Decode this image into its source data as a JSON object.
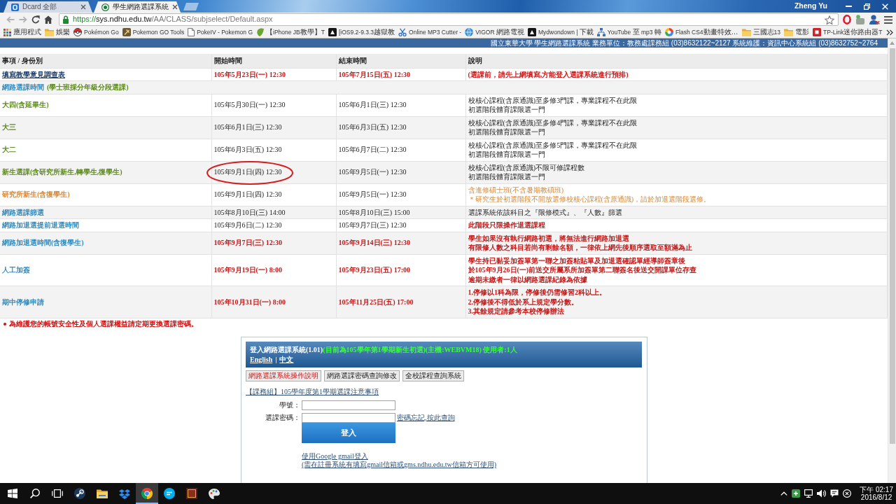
{
  "browser": {
    "tabs": [
      {
        "kind": "tile",
        "title": "Dcard 全部",
        "selected": false
      },
      {
        "kind": "seal",
        "title": "學生網路選課系統",
        "selected": true
      }
    ],
    "user": "Zheng Yu",
    "back_disabled": true,
    "forward_disabled": true,
    "address": {
      "scheme": "https://",
      "host": "sys.ndhu.edu.tw",
      "path": "/AA/CLASS/subjselect/Default.aspx"
    },
    "bookmarks": [
      {
        "kind": "apps",
        "label": "應用程式"
      },
      {
        "kind": "folder",
        "label": "娛樂"
      },
      {
        "kind": "ball",
        "label": "Pokémon Go"
      },
      {
        "kind": "tool",
        "label": "Pokemon GO Tools"
      },
      {
        "kind": "page",
        "label": "PokeIV - Pokemon G"
      },
      {
        "kind": "leaf",
        "label": "【iPhone JB教學】T"
      },
      {
        "kind": "tile",
        "label": "[iOS9.2-9.3.3越獄教"
      },
      {
        "kind": "scissors",
        "label": "Online MP3 Cutter -"
      },
      {
        "kind": "globe",
        "label": "VIGOR 網路電視"
      },
      {
        "kind": "tile",
        "label": "Mydwondown | 下載"
      },
      {
        "kind": "network",
        "label": "YouTube 至 mp3 轉"
      },
      {
        "kind": "pinwheel",
        "label": "Flash CS4動畫特效…"
      },
      {
        "kind": "folder",
        "label": "三國志13"
      },
      {
        "kind": "folder",
        "label": "電影"
      },
      {
        "kind": "logo",
        "label": "TP-Link迷你路由器T"
      }
    ]
  },
  "page": {
    "header": "國立東華大學 學生網路選課系統 業務單位：教務處課務組 (03)8632122~2127 系統維護：資訊中心系統組 (03)8632752~2764",
    "table": {
      "columns": [
        "事項 / 身份別",
        "開始時間",
        "結束時間",
        "說明"
      ],
      "rows": [
        {
          "kind": "survey",
          "item": "填寫教學意見調查表",
          "start": "105年5月23日(一) 12:30",
          "end": "105年7月15日(五) 12:30",
          "dates_emphasized": true,
          "notes": [
            "(選課前，請先上網填寫,方能登入選課系統進行預排)"
          ],
          "notes_emphasized": true,
          "start_circled": false
        },
        {
          "kind": "section",
          "item": "網路選課時間",
          "subtitle": "(學士班採分年級分段選課)"
        },
        {
          "kind": "cohort",
          "item": "大四(含延畢生)",
          "start": "105年5月30日(一) 12:30",
          "end": "105年6月1日(三) 12:30",
          "dates_emphasized": false,
          "notes": [
            "校核心課程(含原通識)至多修3門課，專業課程不在此限",
            "初選階段體育課限選一門"
          ],
          "notes_emphasized": false,
          "start_circled": false
        },
        {
          "kind": "cohort",
          "item": "大三",
          "start": "105年6月1日(三) 12:30",
          "end": "105年6月3日(五) 12:30",
          "dates_emphasized": false,
          "notes": [
            "校核心課程(含原通識)至多修4門課，專業課程不在此限",
            "初選階段體育課限選一門"
          ],
          "notes_emphasized": false,
          "start_circled": false
        },
        {
          "kind": "cohort",
          "item": "大二",
          "start": "105年6月3日(五) 12:30",
          "end": "105年6月7日(二) 12:30",
          "dates_emphasized": false,
          "notes": [
            "校核心課程(含原通識)至多修5門課，專業課程不在此限",
            "初選階段體育課限選一門"
          ],
          "notes_emphasized": false,
          "start_circled": false
        },
        {
          "kind": "cohort",
          "item": "新生選課(含研究所新生,轉學生,復學生)",
          "start": "105年9月1日(四) 12:30",
          "end": "105年9月5日(一) 12:30",
          "dates_emphasized": false,
          "notes": [
            "校核心課程(含原通識)不限可修課程數",
            "初選階段體育課限選一門"
          ],
          "notes_emphasized": false,
          "start_circled": true
        },
        {
          "kind": "graduate",
          "item": "研究所新生(含復學生)",
          "start": "105年9月1日(四) 12:30",
          "end": "105年9月5日(一) 12:30",
          "dates_emphasized": false,
          "notes": [
            "含進修碩士班(不含暑期教碩班)",
            "＊研究生於初選階段不開放選修校核心課程(含原通識)，請於加退選階段選修。"
          ],
          "notes_emphasized": false,
          "start_circled": false
        },
        {
          "kind": "phase",
          "item": "網路選課篩選",
          "start": "105年8月10日(三) 14:00",
          "end": "105年8月10日(三) 15:00",
          "dates_emphasized": false,
          "notes": [
            "選課系統依該科目之『限修模式』、『人數』篩選"
          ],
          "notes_emphasized": false,
          "start_circled": false
        },
        {
          "kind": "phase",
          "item": "網路加退選提前退選時間",
          "start": "105年9月6日(二) 12:30",
          "end": "105年9月7日(三) 12:30",
          "dates_emphasized": false,
          "notes": [
            "此階段只限操作退選課程"
          ],
          "notes_emphasized": true,
          "start_circled": false
        },
        {
          "kind": "phase",
          "item": "網路加退選時間(含復學生)",
          "start": "105年9月7日(三) 12:30",
          "end": "105年9月14日(三) 12:30",
          "dates_emphasized": true,
          "notes": [
            "學生如果沒有執行網路初選，將無法進行網路加退選",
            "有限修人數之科目若尚有剩餘名額，一律依上網先後順序選取至額滿為止"
          ],
          "notes_emphasized": true,
          "start_circled": false
        },
        {
          "kind": "phase",
          "item": "人工加簽",
          "start": "105年9月19日(一) 8:00",
          "end": "105年9月23日(五) 17:00",
          "dates_emphasized": true,
          "notes": [
            "學生持已黏妥加簽單第一聯之加簽粘貼單及加退選確認單經導師簽章後",
            "於105年9月26日(一)前送交所屬系所加簽單第二聯簽名後送交開課單位存查",
            "逾期未繳者一律以網路選課紀錄為依據"
          ],
          "notes_emphasized": true,
          "start_circled": false
        },
        {
          "kind": "phase",
          "item": "期中停修申請",
          "start": "105年10月31日(一) 8:00",
          "end": "105年11月25日(五) 17:00",
          "dates_emphasized": true,
          "notes": [
            "1.停修以1科為限，停修後仍需修習2科以上。",
            "2.停修後不得低於系上規定學分數。",
            "3.其餘規定請參考本校停修辦法"
          ],
          "notes_emphasized": true,
          "start_circled": false
        }
      ]
    },
    "notice": "為維護您的帳號安全性及個人選課權益請定期更換選課密碼。",
    "login": {
      "title": "登入網路選課系統(1.01)",
      "status": "(目前為105學年第1學期新生初選)(主機:WEBVM18) 使用者:1人",
      "languages": [
        "English",
        "中文"
      ],
      "separator": "|",
      "buttons": [
        {
          "label": "網路選課系統操作說明",
          "emphasized": true
        },
        {
          "label": "網路選課密碼查詢修改",
          "emphasized": false
        },
        {
          "label": "全校課程查詢系統",
          "emphasized": false
        }
      ],
      "notice_link": "【課務組】105學年度第1學期選課注意事項",
      "fields": [
        {
          "label": "學號："
        },
        {
          "label": "選課密碼：",
          "link": "密碼忘記,按此查詢"
        }
      ],
      "submit": "登入",
      "gmail_link": "使用Google gmail登入",
      "gmail_note": "(需在註冊系統有填寫gmail信箱或gms.ndhu.edu.tw信箱方可使用)"
    }
  },
  "taskbar": {
    "buttons": [
      {
        "kind": "start",
        "selected": false
      },
      {
        "kind": "search",
        "selected": false
      },
      {
        "kind": "task-view",
        "selected": false
      },
      {
        "kind": "circle-app",
        "selected": false
      },
      {
        "kind": "folder",
        "selected": false
      },
      {
        "kind": "box",
        "selected": false
      },
      {
        "kind": "browser",
        "selected": true
      },
      {
        "kind": "chat",
        "selected": false
      },
      {
        "kind": "game",
        "selected": false
      },
      {
        "kind": "palette",
        "selected": false
      }
    ],
    "time": "下午 02:17",
    "date": "2016/8/12"
  }
}
